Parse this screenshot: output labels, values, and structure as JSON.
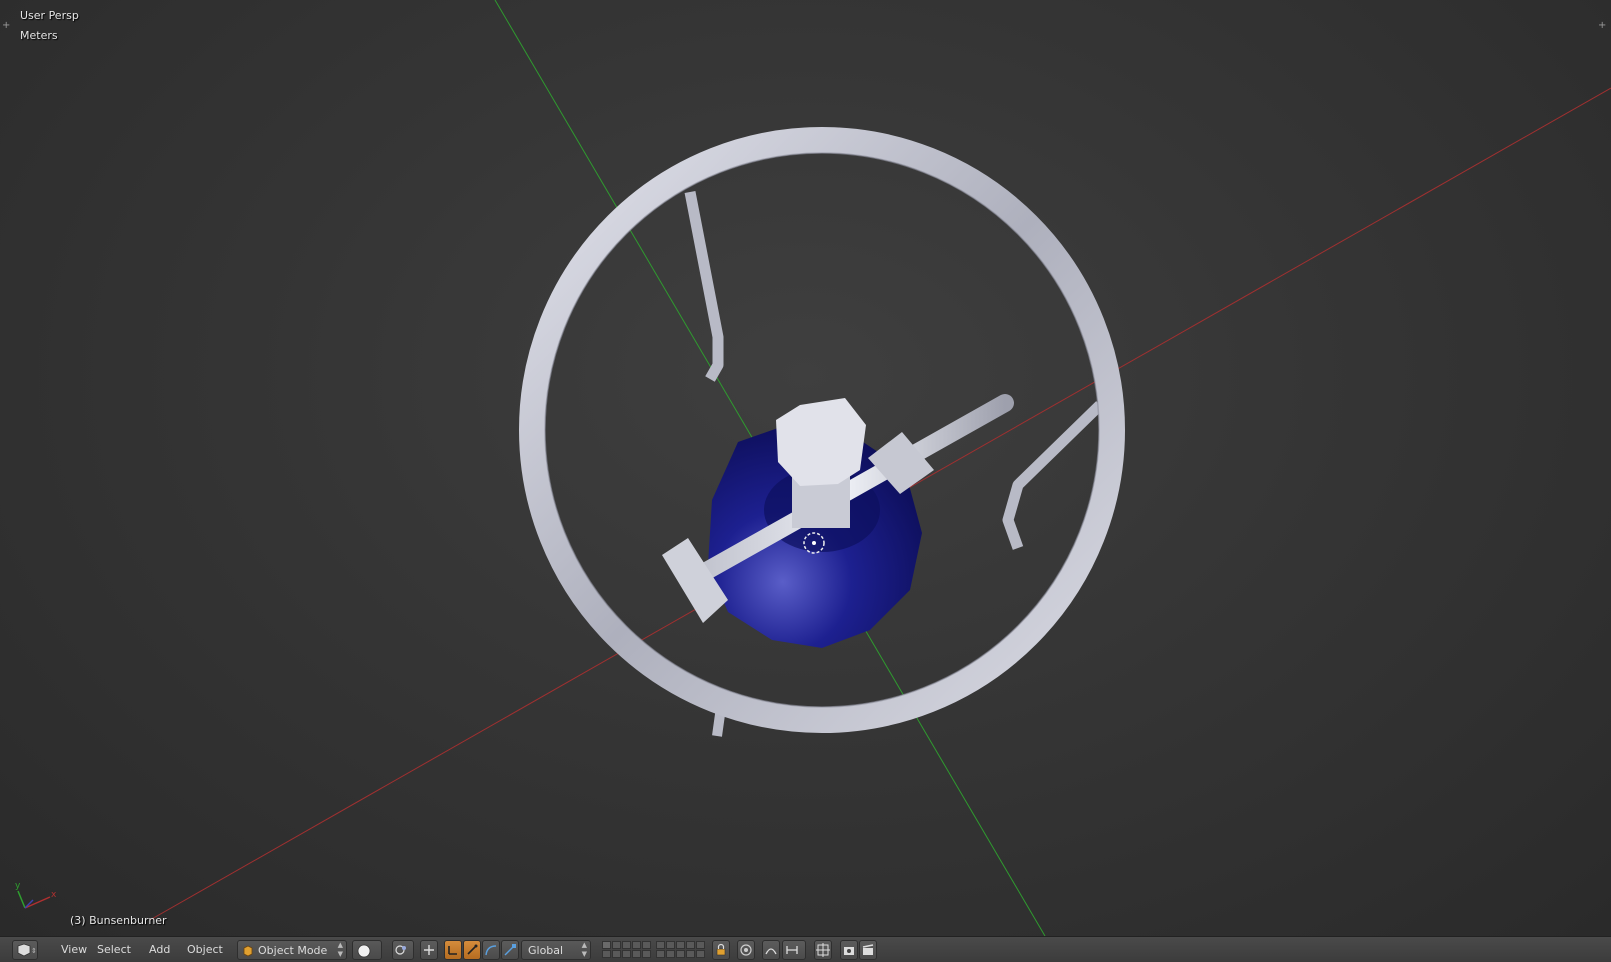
{
  "viewport": {
    "view_label": "User Persp",
    "units_label": "Meters",
    "object_label": "(3) Bunsenburner",
    "axis_widget": {
      "y": "y",
      "x": "x"
    },
    "colors": {
      "x_axis": "#b03030",
      "y_axis": "#2fa02f",
      "burner_base": "#1c1f8c",
      "metal": "#c8cad6"
    }
  },
  "header": {
    "menus": [
      "View",
      "Select",
      "Add",
      "Object"
    ],
    "mode": "Object Mode",
    "orientation": "Global",
    "icons": [
      "editor-type-icon",
      "viewport-shading-icon",
      "pivot-point-icon",
      "manipulator-icon",
      "translate-icon",
      "rotate-icon",
      "scale-icon",
      "layers-icon",
      "lock-icon",
      "proportional-edit-icon",
      "snap-icon",
      "render-icon"
    ]
  }
}
